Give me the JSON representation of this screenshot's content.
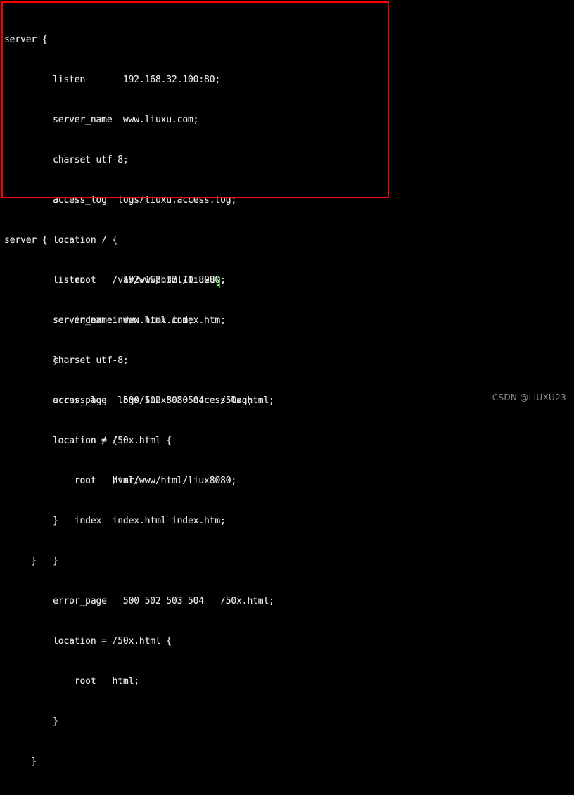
{
  "terminal": {
    "background_color": "#000000",
    "foreground_color": "#e4e4e4",
    "cursor_color": "#00c000",
    "annotation_color": "#fe0000"
  },
  "blocks": [
    {
      "id": "server-block-liuxu",
      "highlighted": true,
      "lines": [
        "server {",
        "         listen       192.168.32.100:80;",
        "         server_name  www.liuxu.com;",
        "         charset utf-8;",
        "         access_log  logs/liuxu.access.log;",
        "         location / {",
        "             root   /var/www/html/liuxu",
        "             index  index.html index.htm;",
        "         }",
        "         error_page   500 502 503 504   /50x.html;",
        "         location = /50x.html {",
        "             root   html;",
        "         }",
        "     }"
      ],
      "cursor_line_index": 6,
      "cursor_char": ";"
    },
    {
      "id": "server-block-liux8080",
      "highlighted": false,
      "lines": [
        "server {",
        "         listen       192.168.32.10:8080;",
        "         server_name  www.liux.com;",
        "         charset utf-8;",
        "         access_log  logs/liux8080.access.log;",
        "         location / {",
        "             root   /var/www/html/liux8080;",
        "             index  index.html index.htm;",
        "         }",
        "         error_page   500 502 503 504   /50x.html;",
        "         location = /50x.html {",
        "             root   html;",
        "         }",
        "     }"
      ]
    }
  ],
  "watermark": {
    "text": "CSDN @LIUXU23"
  }
}
